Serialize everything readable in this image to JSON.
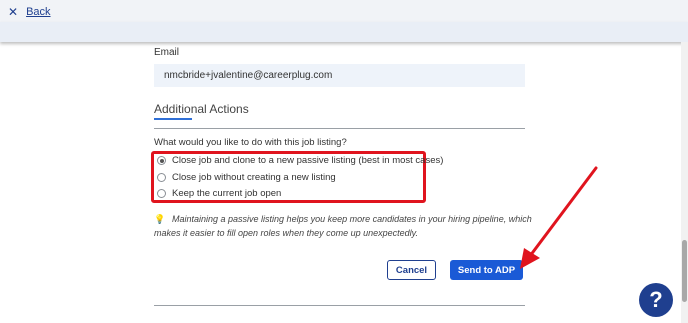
{
  "header": {
    "close_glyph": "✕",
    "back_label": "Back"
  },
  "form": {
    "email_label": "Email",
    "email_value": "nmcbride+jvalentine@careerplug.com"
  },
  "additional_actions": {
    "title": "Additional Actions",
    "question": "What would you like to do with this job listing?",
    "options": [
      {
        "label": "Close job and clone to a new passive listing (best in most cases)",
        "selected": true
      },
      {
        "label": "Close job without creating a new listing",
        "selected": false
      },
      {
        "label": "Keep the current job open",
        "selected": false
      }
    ],
    "tip_icon": "lightbulb-icon",
    "tip_glyph": "💡",
    "tip_text": "Maintaining a passive listing helps you keep more candidates in your hiring pipeline, which makes it easier to fill open roles when they come up unexpectedly."
  },
  "buttons": {
    "cancel_label": "Cancel",
    "send_label": "Send to ADP"
  },
  "help": {
    "glyph": "?"
  },
  "colors": {
    "highlight": "#e0141e",
    "primary": "#1a5ad6",
    "navy": "#1f3f8f"
  }
}
